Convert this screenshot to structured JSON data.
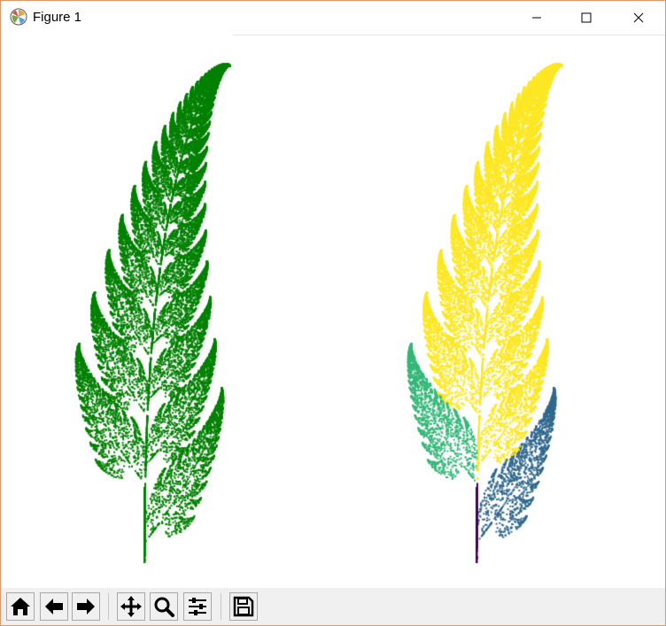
{
  "window": {
    "title": "Figure 1",
    "controls": [
      "minimize-icon",
      "maximize-icon",
      "close-icon"
    ]
  },
  "figure": {
    "panels": [
      {
        "name": "fern-solid",
        "color": "#008000",
        "points": 26000
      },
      {
        "name": "fern-colored-by-transform",
        "colors": {
          "stem": "#440154",
          "left_leaflet": "#31688e",
          "right_leaflet": "#35b779",
          "body": "#fde725"
        },
        "points": 26000
      }
    ]
  },
  "toolbar": {
    "buttons": [
      "home-icon",
      "back-icon",
      "forward-icon",
      "pan-icon",
      "zoom-icon",
      "configure-icon",
      "save-icon"
    ]
  }
}
